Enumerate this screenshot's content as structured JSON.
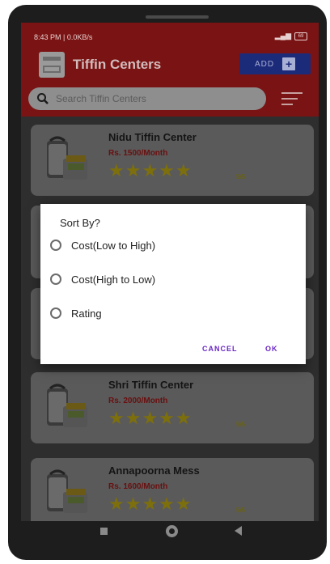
{
  "status_bar": {
    "time_speed": "8:43 PM | 0.0KB/s",
    "battery": "69"
  },
  "app_bar": {
    "title": "Tiffin Centers",
    "add_label": "ADD",
    "add_icon": "plus-icon"
  },
  "search": {
    "placeholder": "Search Tiffin Centers",
    "icon": "search-icon",
    "filter_icon": "sort-icon"
  },
  "centers": [
    {
      "name": "Nidu Tiffin Center",
      "price": "Rs. 1500/Month",
      "stars": "★★★★★",
      "rating": "5/5"
    },
    {
      "name": "Shri Tiffin Center",
      "price": "Rs. 2000/Month",
      "stars": "★★★★★",
      "rating": "5/5"
    },
    {
      "name": "Annapoorna Mess",
      "price": "Rs. 1600/Month",
      "stars": "★★★★★",
      "rating": "5/5"
    }
  ],
  "dialog": {
    "title": "Sort By?",
    "options": [
      "Cost(Low to High)",
      "Cost(High to Low)",
      "Rating"
    ],
    "cancel": "CANCEL",
    "ok": "OK"
  },
  "colors": {
    "header": "#d32f2f",
    "add_button": "#3f51b5",
    "star": "#ffd600",
    "price": "#c62828",
    "dialog_button": "#6a28c6"
  }
}
